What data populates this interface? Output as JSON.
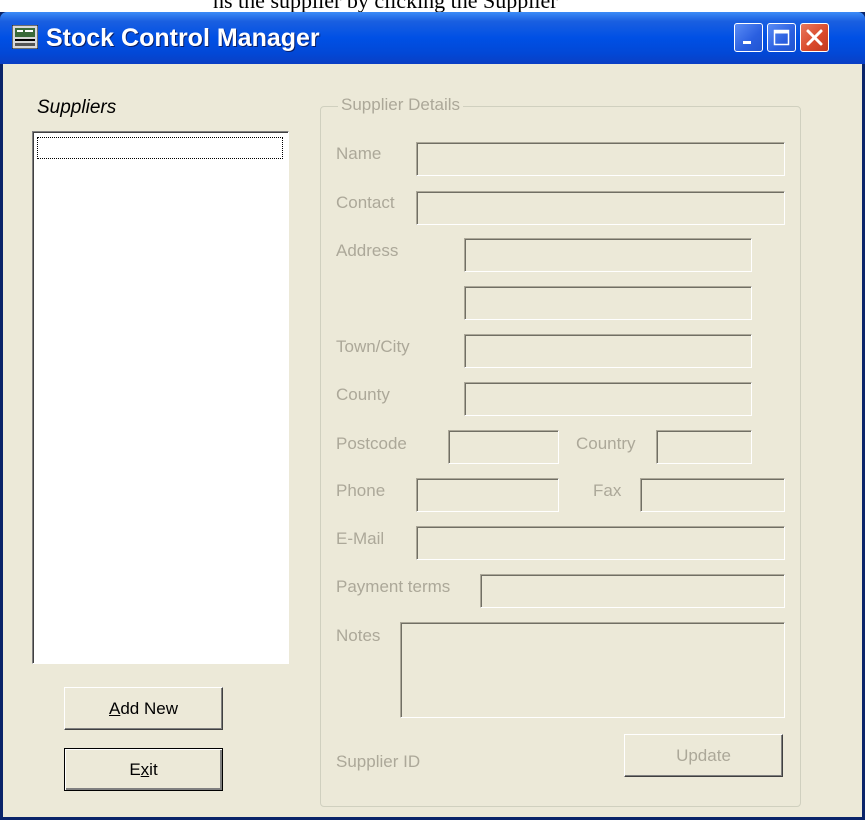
{
  "caption": {
    "text": "ns the supplier by clicking the Supplier"
  },
  "window": {
    "title": "Stock Control Manager",
    "icons": [
      "app-icon",
      "minimize-icon",
      "maximize-icon",
      "close-icon"
    ]
  },
  "left": {
    "suppliers_label": "Suppliers",
    "suppliers_list": [],
    "add_new": {
      "pre": "",
      "mn": "A",
      "post": "dd New"
    },
    "exit": {
      "pre": "E",
      "mn": "x",
      "post": "it"
    }
  },
  "details": {
    "group_label": "Supplier Details",
    "labels": {
      "name": "Name",
      "contact": "Contact",
      "address": "Address",
      "town": "Town/City",
      "county": "County",
      "postcode": "Postcode",
      "country": "Country",
      "phone": "Phone",
      "fax": "Fax",
      "email": "E-Mail",
      "payment": "Payment terms",
      "notes": "Notes",
      "supplier_id": "Supplier ID"
    },
    "values": {
      "name": "",
      "contact": "",
      "address1": "",
      "address2": "",
      "town": "",
      "county": "",
      "postcode": "",
      "country": "",
      "phone": "",
      "fax": "",
      "email": "",
      "payment": "",
      "notes": ""
    },
    "update_label": "Update"
  },
  "colors": {
    "titlebar": "#0050e5",
    "client_bg": "#ece9d8",
    "disabled_text": "#aca899",
    "close_button": "#d8482a"
  }
}
